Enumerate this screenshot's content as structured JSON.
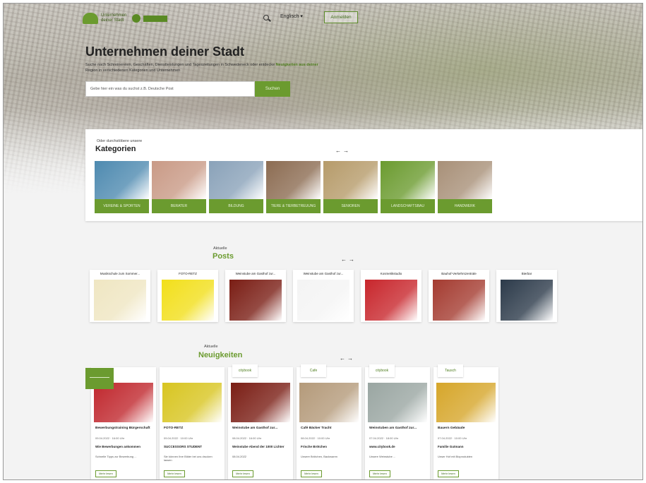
{
  "header": {
    "logo_text": "Unternehmen deiner Stadt",
    "language": "Englisch ▾",
    "login_label": "Anmelden"
  },
  "hero": {
    "title": "Unternehmen deiner Stadt",
    "subtitle": "Suche nach Schreinereien, Geschäften, Dienstleistungen und Tageszeitungen in Schwedeneck oder entdecke ",
    "subtitle_link": "Neuigkeiten aus deiner",
    "subtitle_end": " Region in verschiedenen Kategorien und Unternehmen",
    "search_placeholder": "Gebe hier ein was du suchst z.B. Deutsche Post",
    "search_button": "Suchen"
  },
  "categories": {
    "pre": "Oder durchstöbere unsere",
    "title": "Kategorien",
    "items": [
      {
        "label": "VEREINE & SPORTEN",
        "color": "#4e8ab0"
      },
      {
        "label": "BERATER",
        "color": "#c99a86"
      },
      {
        "label": "BILDUNG",
        "color": "#8aa2b9"
      },
      {
        "label": "TIERE & TIERBETREUUNG",
        "color": "#8c6c52"
      },
      {
        "label": "SENIOREN",
        "color": "#b69b6a"
      },
      {
        "label": "LANDSCHAFTSBAU",
        "color": "#6b9b2f"
      },
      {
        "label": "HANDWERK",
        "color": "#a89078"
      }
    ]
  },
  "posts": {
    "pre": "Aktuelle",
    "title": "Posts",
    "items": [
      {
        "title": "Musikschule zum Sommer...",
        "color": "#efe6c2"
      },
      {
        "title": "FOTO-RETZ",
        "color": "#f2df1a"
      },
      {
        "title": "Weinstube am Gasthof zur...",
        "color": "#7a1d14"
      },
      {
        "title": "Weinstube am Gasthof zur...",
        "color": "#f4f4f4"
      },
      {
        "title": "Kosmetikstudio",
        "color": "#c8262c"
      },
      {
        "title": "Bauhof-Verkehrszentrale",
        "color": "#a43b30"
      },
      {
        "title": "Bierbar",
        "color": "#2c3a4a"
      }
    ]
  },
  "news": {
    "pre": "Aktuelle",
    "title": "Neuigkeiten",
    "items": [
      {
        "badge": "",
        "title": "Bewerbungstraining Bürgerschaft",
        "date": "09.04.2022 · 16:00 Uhr",
        "subtitle": "Wie Bewerbungen ankommen",
        "text": "Schnelle Tipps zur Bewerbung ...",
        "button": "Mehr lesen",
        "color": "#c0272d"
      },
      {
        "badge": "",
        "title": "FOTO-RETZ",
        "date": "09.04.2022 · 10:00 Uhr",
        "subtitle": "SUCCESSORS STUDENT",
        "text": "Sie können Ihre Bilder bei uns drucken lassen",
        "button": "Mehr lesen",
        "color": "#d8c520"
      },
      {
        "badge": "citybook",
        "title": "Weinstube am Gasthof zur...",
        "date": "08.04.2022 · 16:00 Uhr",
        "subtitle": "Weinstube Abend der 1000 Lichter",
        "text": "08.04.2022",
        "button": "Mehr lesen",
        "color": "#7a1d14"
      },
      {
        "badge": "Cafe",
        "title": "Café Bäcker Tracht",
        "date": "08.04.2022 · 10:00 Uhr",
        "subtitle": "Frische Brötchen",
        "text": "Unsere Brötchen, Backwaren",
        "button": "Mehr lesen",
        "color": "#b49a7a"
      },
      {
        "badge": "citybook",
        "title": "Weinstuben am Gasthof zur...",
        "date": "07.04.2022 · 18:00 Uhr",
        "subtitle": "www.citybook.de",
        "text": "Unsere Weinstube ...",
        "button": "Mehr lesen",
        "color": "#9aa6a2"
      },
      {
        "badge": "Tausch",
        "title": "Bauern Gebäude",
        "date": "07.04.2022 · 10:00 Uhr",
        "subtitle": "Familie Gutmann",
        "text": "Unser Hof mit Bioprodukten",
        "button": "Mehr lesen",
        "color": "#d6a62a"
      }
    ]
  }
}
